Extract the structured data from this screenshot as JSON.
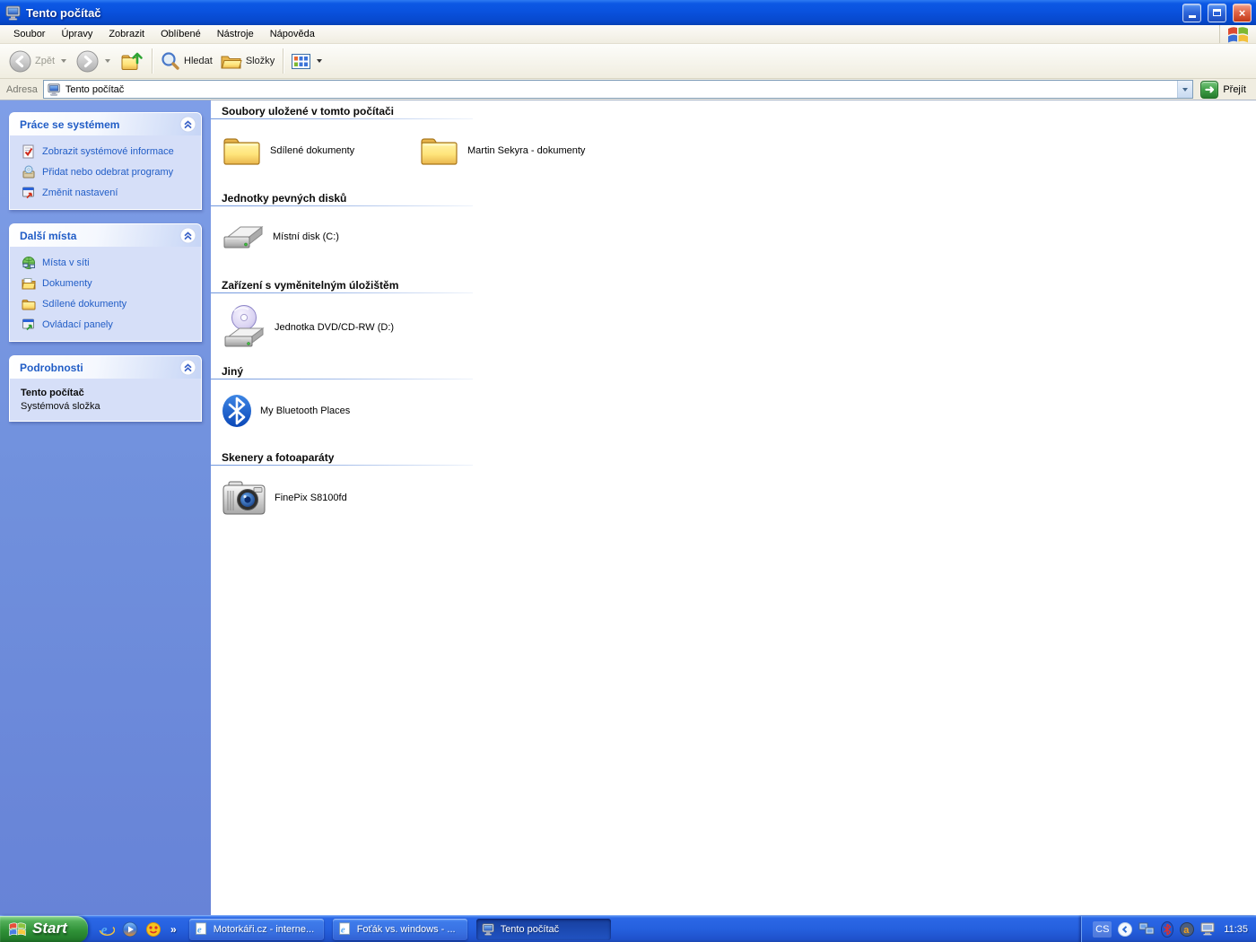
{
  "window": {
    "title": "Tento počítač",
    "controls": {
      "minimize": "_",
      "restore": "❐",
      "close": "✕"
    }
  },
  "menu": {
    "items": [
      "Soubor",
      "Úpravy",
      "Zobrazit",
      "Oblíbené",
      "Nástroje",
      "Nápověda"
    ]
  },
  "toolbar": {
    "back_label": "Zpět",
    "search_label": "Hledat",
    "folders_label": "Složky"
  },
  "address": {
    "label": "Adresa",
    "value": "Tento počítač",
    "go_label": "Přejít"
  },
  "sidebar": {
    "panels": [
      {
        "title": "Práce se systémem",
        "items": [
          {
            "label": "Zobrazit systémové informace",
            "icon": "system-info-icon"
          },
          {
            "label": "Přidat nebo odebrat programy",
            "icon": "add-remove-programs-icon"
          },
          {
            "label": "Změnit nastavení",
            "icon": "change-settings-icon"
          }
        ]
      },
      {
        "title": "Další místa",
        "items": [
          {
            "label": "Místa v síti",
            "icon": "network-places-icon"
          },
          {
            "label": "Dokumenty",
            "icon": "documents-icon"
          },
          {
            "label": "Sdílené dokumenty",
            "icon": "shared-documents-icon"
          },
          {
            "label": "Ovládací panely",
            "icon": "control-panel-icon"
          }
        ]
      },
      {
        "title": "Podrobnosti",
        "details": {
          "title": "Tento počítač",
          "subtitle": "Systémová složka"
        }
      }
    ]
  },
  "content": {
    "sections": [
      {
        "title": "Soubory uložené v tomto počítači",
        "items": [
          {
            "label": "Sdílené dokumenty",
            "icon": "folder-icon"
          },
          {
            "label": "Martin Sekyra - dokumenty",
            "icon": "folder-icon"
          }
        ]
      },
      {
        "title": "Jednotky pevných disků",
        "items": [
          {
            "label": "Místní disk (C:)",
            "icon": "hard-disk-icon"
          }
        ]
      },
      {
        "title": "Zařízení s vyměnitelným úložištěm",
        "items": [
          {
            "label": "Jednotka DVD/CD-RW (D:)",
            "icon": "dvd-drive-icon"
          }
        ]
      },
      {
        "title": "Jiný",
        "items": [
          {
            "label": "My Bluetooth Places",
            "icon": "bluetooth-icon"
          }
        ]
      },
      {
        "title": "Skenery a fotoaparáty",
        "items": [
          {
            "label": "FinePix S8100fd",
            "icon": "camera-icon"
          }
        ]
      }
    ]
  },
  "taskbar": {
    "start_label": "Start",
    "quick_launch": {
      "more_glyph": "»"
    },
    "tasks": [
      {
        "label": "Motorkáři.cz - interne...",
        "icon": "ie-icon",
        "active": false
      },
      {
        "label": "Foťák vs. windows - ...",
        "icon": "ie-icon",
        "active": false
      },
      {
        "label": "Tento počítač",
        "icon": "computer-icon",
        "active": true
      }
    ],
    "tray": {
      "language": "CS",
      "time": "11:35"
    }
  },
  "colors": {
    "titlebar_blue": "#0A52DE",
    "taskbar_blue": "#2560DE",
    "start_green": "#2F9137",
    "sidebar_blue": "#7191DD",
    "panel_body": "#D6DFF8",
    "panel_link_blue": "#215DC6",
    "active_task_blue": "#1C4AB2",
    "go_button_green": "#3E9E46",
    "close_button_red": "#C23A18"
  }
}
